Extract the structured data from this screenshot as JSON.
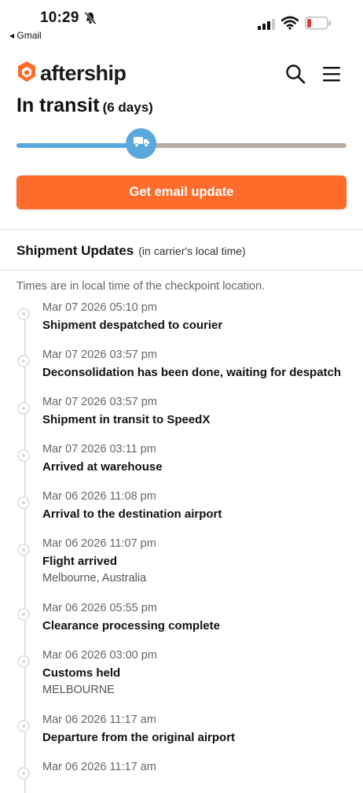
{
  "status_bar": {
    "time": "10:29",
    "back_label": "◂ Gmail"
  },
  "header": {
    "logo_text": "aftership",
    "brand_color": "#ff6b2b"
  },
  "shipment": {
    "status": "In transit",
    "duration": "(6 days)",
    "progress_fraction": 0.42,
    "progress_color": "#5aa7dd",
    "track_color": "#b5ada2"
  },
  "cta": {
    "label": "Get email update",
    "color": "#ff6b2b"
  },
  "updates": {
    "heading": "Shipment Updates",
    "heading_note": "(in carrier's local time)",
    "timezone_note": "Times are in local time of the checkpoint location.",
    "events": [
      {
        "date": "Mar 07 2026 05:10 pm",
        "desc": "Shipment despatched to courier",
        "location": ""
      },
      {
        "date": "Mar 07 2026 03:57 pm",
        "desc": "Deconsolidation has been done, waiting for despatch",
        "location": ""
      },
      {
        "date": "Mar 07 2026 03:57 pm",
        "desc": "Shipment in transit to SpeedX",
        "location": ""
      },
      {
        "date": "Mar 07 2026 03:11 pm",
        "desc": "Arrived at warehouse",
        "location": ""
      },
      {
        "date": "Mar 06 2026 11:08 pm",
        "desc": "Arrival to the destination airport",
        "location": ""
      },
      {
        "date": "Mar 06 2026 11:07 pm",
        "desc": "Flight arrived",
        "location": "Melbourne, Australia"
      },
      {
        "date": "Mar 06 2026 05:55 pm",
        "desc": "Clearance processing complete",
        "location": ""
      },
      {
        "date": "Mar 06 2026 03:00 pm",
        "desc": "Customs held",
        "location": "MELBOURNE"
      },
      {
        "date": "Mar 06 2026 11:17 am",
        "desc": "Departure from the original airport",
        "location": ""
      },
      {
        "date": "Mar 06 2026 11:17 am",
        "desc": "",
        "location": ""
      }
    ]
  }
}
